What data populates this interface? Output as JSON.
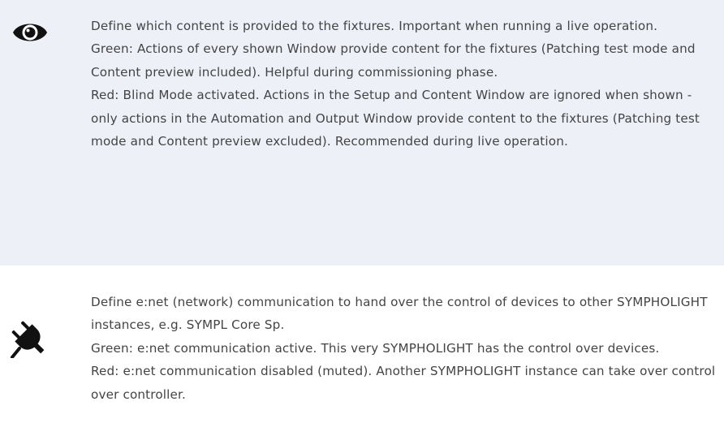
{
  "blind_mode": {
    "icon": "eye-icon",
    "paragraphs": [
      "Define which content is provided to the fixtures. Important when running a live operation.",
      "Green: Actions of every shown Window provide content for  the fixtures (Patching test mode and Content preview included). Helpful during commissioning phase.",
      "Red: Blind Mode activated. Actions in the Setup and Content Window are ignored when shown - only actions in the Automation and Output Window provide content to the fixtures (Patching test mode and Content preview excluded). Recommended during live operation."
    ]
  },
  "enet_mute": {
    "icon": "plug-icon",
    "paragraphs": [
      "Define e:net (network) communication to hand over the control of devices to other SYMPHOLIGHT instances, e.g. SYMPL Core Sp.",
      "Green: e:net communication active. This very SYMPHOLIGHT has the control over devices.",
      "Red: e:net communication disabled (muted). Another SYMPHOLIGHT instance can take over control over controller."
    ]
  },
  "colors": {
    "highlight_row": "#eef0f7",
    "text": "#444444",
    "icon": "#111111"
  }
}
